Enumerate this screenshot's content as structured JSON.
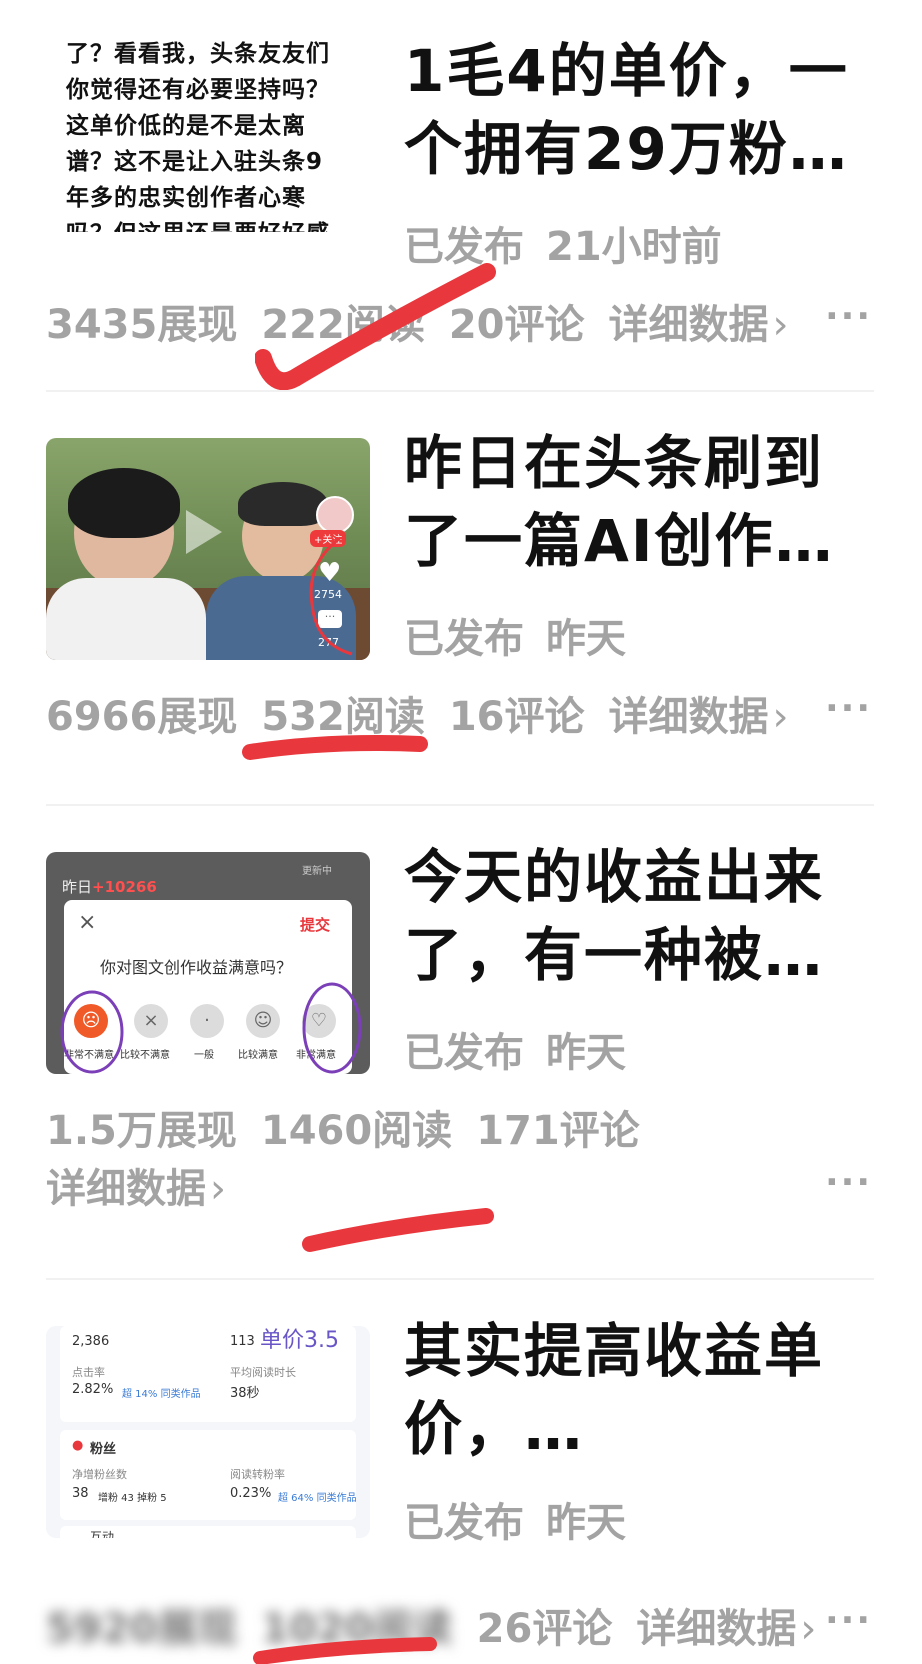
{
  "articles": [
    {
      "thumb_lines": [
        "了？看看我，头条友友们",
        "你觉得还有必要坚持吗？",
        "这单价低的是不是太离",
        "谱？这不是让入驻头条9",
        "年多的忠实创作者心寒",
        "吗？但这里还是要好好感"
      ],
      "title_line1": "1毛4的单价，一",
      "title_line2": "个拥有29万粉…",
      "status": "已发布",
      "time": "21小时前",
      "impressions": "3435展现",
      "reads": "222阅读",
      "comments": "20评论",
      "details": "详细数据",
      "chevron": "›",
      "more": "···"
    },
    {
      "thumb_badge": "+关注",
      "thumb_likes": "2754",
      "thumb_comments": "277",
      "title_line1": "昨日在头条刷到",
      "title_line2": "了一篇AI创作…",
      "status": "已发布",
      "time": "昨天",
      "impressions": "6966展现",
      "reads": "532阅读",
      "comments": "16评论",
      "details": "详细数据",
      "chevron": "›",
      "more": "···"
    },
    {
      "thumb_yesterday": "昨日",
      "thumb_value": "+10266",
      "thumb_updating": "更新中",
      "thumb_close": "×",
      "thumb_submit": "提交",
      "thumb_question": "你对图文创作收益满意吗？",
      "thumb_options": [
        "非常不满意",
        "比较不满意",
        "一般",
        "比较满意",
        "非常满意"
      ],
      "title_line1": "今天的收益出来",
      "title_line2": "了，有一种被…",
      "status": "已发布",
      "time": "昨天",
      "impressions": "1.5万展现",
      "reads": "1460阅读",
      "comments": "171评论",
      "details": "详细数据",
      "chevron": "›",
      "more": "···"
    },
    {
      "thumb_stats": {
        "v1": "2,386",
        "v2": "113",
        "unit_price": "单价3.5",
        "ctr_label": "点击率",
        "ctr_value": "2.82%",
        "ctr_note": "超 14% 同类作品",
        "avg_time_label": "平均阅读时长",
        "avg_time_value": "38秒",
        "fans_label": "粉丝",
        "net_fans_label": "净增粉丝数",
        "net_fans_value": "38",
        "net_fans_detail": "增粉 43  掉粉 5",
        "conv_label": "阅读转粉率",
        "conv_value": "0.23%",
        "conv_note": "超 64% 同类作品",
        "interact_label": "互动"
      },
      "title_line1": "其实提高收益单",
      "title_line2": "价，…",
      "status": "已发布",
      "time": "昨天",
      "impressions_blurred": "5920展现",
      "reads_blurred": "1020阅读",
      "comments": "26评论",
      "details": "详细数据",
      "chevron": "›",
      "more": "···"
    }
  ],
  "colors": {
    "annotation_red": "#e8383d",
    "annotation_purple": "#7b3fb8",
    "meta_gray": "#a3a3a3",
    "title_black": "#111111"
  }
}
